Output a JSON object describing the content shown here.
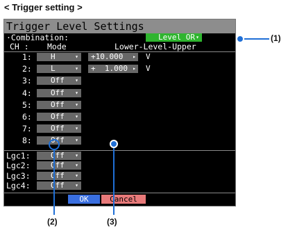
{
  "caption": "< Trigger setting >",
  "window": {
    "title": "Trigger Level Settings"
  },
  "combination": {
    "label": "·Combination:",
    "value": "Level OR",
    "arrow": "▾"
  },
  "headers": {
    "ch": "CH :",
    "mode": "Mode",
    "level": "Lower-Level-Upper"
  },
  "channels": [
    {
      "label": "1:",
      "mode": "H",
      "level": "+10.000",
      "unit": "V"
    },
    {
      "label": "2:",
      "mode": "L",
      "level": "+  1.000",
      "unit": "V"
    },
    {
      "label": "3:",
      "mode": "Off"
    },
    {
      "label": "4:",
      "mode": "Off"
    },
    {
      "label": "5:",
      "mode": "Off"
    },
    {
      "label": "6:",
      "mode": "Off"
    },
    {
      "label": "7:",
      "mode": "Off"
    },
    {
      "label": "8:",
      "mode": "Off"
    }
  ],
  "logic": [
    {
      "label": "Lgc1:",
      "mode": "Off"
    },
    {
      "label": "Lgc2:",
      "mode": "Off"
    },
    {
      "label": "Lgc3:",
      "mode": "Off"
    },
    {
      "label": "Lgc4:",
      "mode": "Off"
    }
  ],
  "dropdown_arrow": "▾",
  "level_arrow": "▸",
  "buttons": {
    "ok": "OK",
    "cancel": "Cancel"
  },
  "callouts": {
    "c1": "(1)",
    "c2": "(2)",
    "c3": "(3)"
  },
  "colors": {
    "combo_bg": "#2fb52f",
    "ok_bg": "#3a6fe0",
    "cancel_bg": "#e87a7a",
    "callout": "#1f6fd6"
  }
}
